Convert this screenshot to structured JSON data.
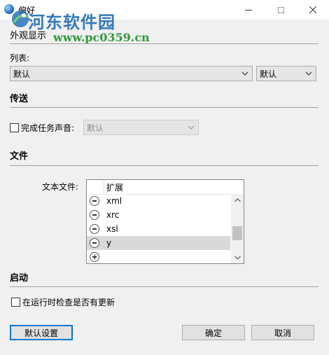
{
  "window": {
    "title": "偏好"
  },
  "watermark": {
    "site_name": "河东软件园",
    "url": "www.pc0359.cn"
  },
  "appearance": {
    "title": "外观显示",
    "list_label": "列表:",
    "list_combo_value": "默认",
    "list_combo2_value": "默认"
  },
  "transfer": {
    "title": "传送",
    "sound_checkbox_label": "完成任务声音:",
    "sound_checked": false,
    "sound_combo_value": "默认"
  },
  "files": {
    "title": "文件",
    "text_files_label": "文本文件:",
    "column_header": "扩展",
    "extensions": [
      "xml",
      "xrc",
      "xsl",
      "y"
    ],
    "selected_extension": "y"
  },
  "startup": {
    "title": "启动",
    "update_check_label": "在运行时检查是否有更新",
    "update_checked": false
  },
  "buttons": {
    "defaults_label": "默认设置",
    "ok_label": "确定",
    "cancel_label": "取消"
  },
  "colors": {
    "accent": "#0078d7",
    "watermark_blue": "#2a73b8",
    "watermark_green": "#2e9a3a"
  },
  "icons": [
    "app-icon",
    "minimize-icon",
    "maximize-icon",
    "close-icon",
    "chevron-down-icon",
    "remove-icon",
    "add-icon",
    "scroll-up-icon",
    "scroll-down-icon"
  ]
}
